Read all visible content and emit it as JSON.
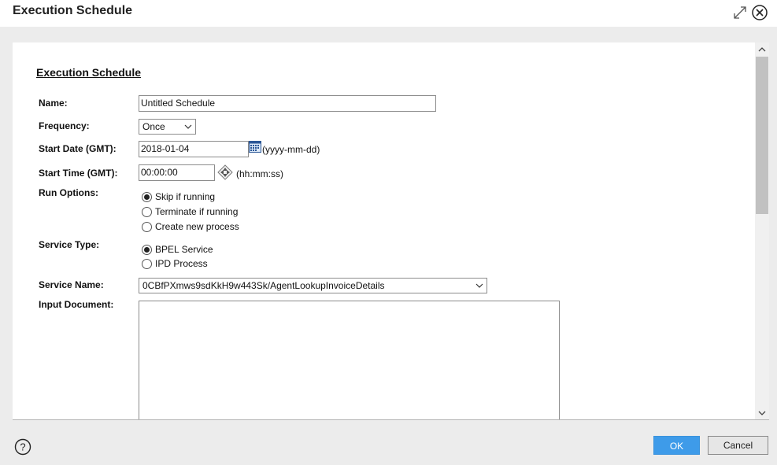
{
  "window": {
    "title": "Execution Schedule",
    "icons": {
      "maximize": "expand-icon",
      "close": "close-circle-icon"
    }
  },
  "form": {
    "section_title": "Execution Schedule",
    "name": {
      "label": "Name:",
      "value": "Untitled Schedule"
    },
    "frequency": {
      "label": "Frequency:",
      "value": "Once"
    },
    "start_date": {
      "label": "Start Date (GMT):",
      "value": "2018-01-04",
      "hint": "(yyyy-mm-dd)"
    },
    "start_time": {
      "label": "Start Time (GMT):",
      "value": "00:00:00",
      "hint": "(hh:mm:ss)"
    },
    "run_options": {
      "label": "Run Options:",
      "options": [
        {
          "label": "Skip if running",
          "checked": true
        },
        {
          "label": "Terminate if running",
          "checked": false
        },
        {
          "label": "Create new process",
          "checked": false
        }
      ]
    },
    "service_type": {
      "label": "Service Type:",
      "options": [
        {
          "label": "BPEL Service",
          "checked": true
        },
        {
          "label": "IPD Process",
          "checked": false
        }
      ]
    },
    "service_name": {
      "label": "Service Name:",
      "value": "0CBfPXmws9sdKkH9w443Sk/AgentLookupInvoiceDetails"
    },
    "input_document": {
      "label": "Input Document:",
      "value": ""
    }
  },
  "footer": {
    "ok_label": "OK",
    "cancel_label": "Cancel",
    "help_icon": "help-icon"
  },
  "colors": {
    "ok_button": "#3e9be9",
    "background": "#ececec",
    "panel": "#ffffff"
  }
}
